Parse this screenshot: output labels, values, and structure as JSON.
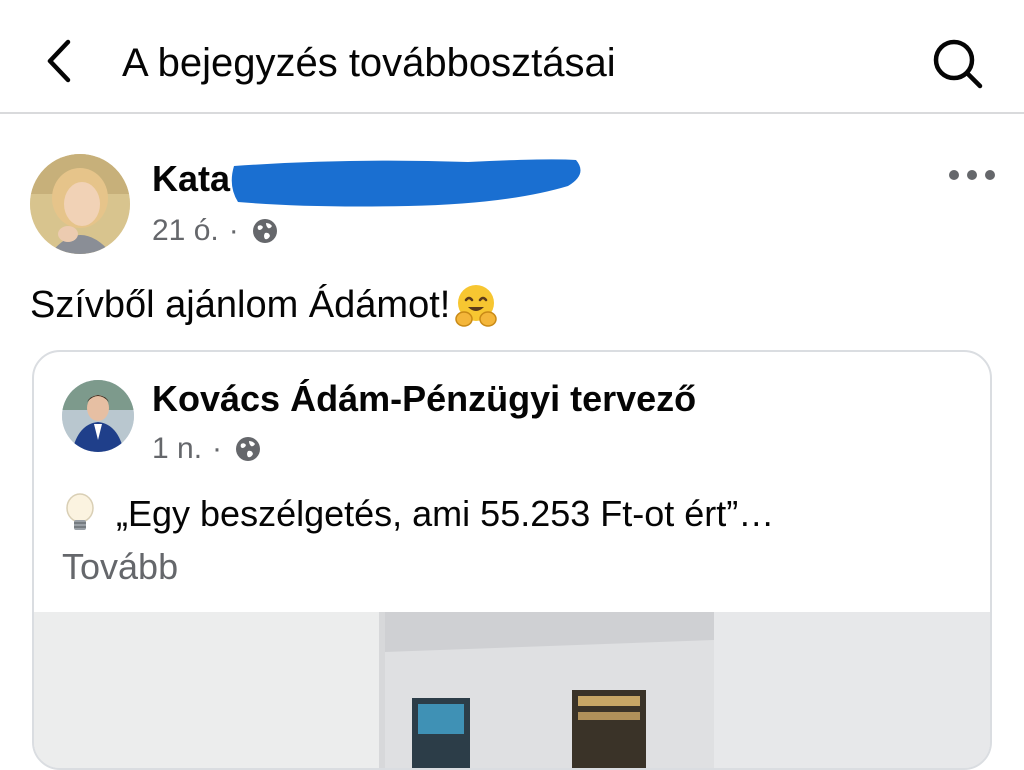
{
  "header": {
    "title": "A bejegyzés továbbosztásai",
    "back_icon": "chevron-left-icon",
    "search_icon": "search-icon"
  },
  "post": {
    "author_name": "Kata",
    "time": "21 ó.",
    "separator": "·",
    "privacy_icon": "globe-icon",
    "more_icon": "more-horizontal-icon",
    "text": "Szívből ajánlom Ádámot!",
    "emoji": "hugging-face-icon"
  },
  "shared_post": {
    "author_name": "Kovács Ádám-Pénzügyi tervező",
    "time": "1 n.",
    "separator": "·",
    "privacy_icon": "globe-icon",
    "text": "„Egy beszélgetés, ami 55.253 Ft-ot ért”…",
    "emoji": "light-bulb-icon",
    "more_label": "Tovább"
  },
  "colors": {
    "text_primary": "#050505",
    "text_secondary": "#65676b",
    "redaction_blue": "#1a6fd1",
    "divider": "#d9dadc"
  }
}
